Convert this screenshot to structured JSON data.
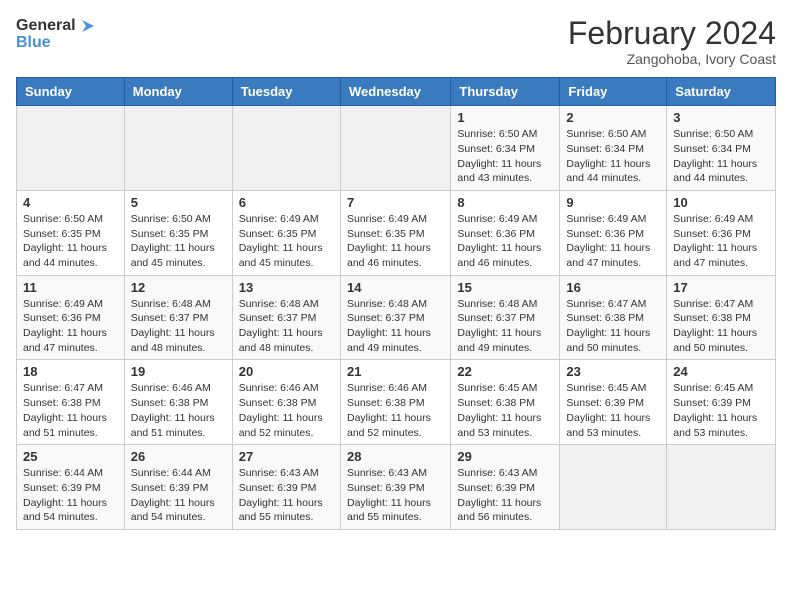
{
  "header": {
    "logo_line1": "General",
    "logo_line2": "Blue",
    "month_year": "February 2024",
    "location": "Zangohoba, Ivory Coast"
  },
  "days_of_week": [
    "Sunday",
    "Monday",
    "Tuesday",
    "Wednesday",
    "Thursday",
    "Friday",
    "Saturday"
  ],
  "weeks": [
    [
      {
        "day": "",
        "info": ""
      },
      {
        "day": "",
        "info": ""
      },
      {
        "day": "",
        "info": ""
      },
      {
        "day": "",
        "info": ""
      },
      {
        "day": "1",
        "info": "Sunrise: 6:50 AM\nSunset: 6:34 PM\nDaylight: 11 hours and 43 minutes."
      },
      {
        "day": "2",
        "info": "Sunrise: 6:50 AM\nSunset: 6:34 PM\nDaylight: 11 hours and 44 minutes."
      },
      {
        "day": "3",
        "info": "Sunrise: 6:50 AM\nSunset: 6:34 PM\nDaylight: 11 hours and 44 minutes."
      }
    ],
    [
      {
        "day": "4",
        "info": "Sunrise: 6:50 AM\nSunset: 6:35 PM\nDaylight: 11 hours and 44 minutes."
      },
      {
        "day": "5",
        "info": "Sunrise: 6:50 AM\nSunset: 6:35 PM\nDaylight: 11 hours and 45 minutes."
      },
      {
        "day": "6",
        "info": "Sunrise: 6:49 AM\nSunset: 6:35 PM\nDaylight: 11 hours and 45 minutes."
      },
      {
        "day": "7",
        "info": "Sunrise: 6:49 AM\nSunset: 6:35 PM\nDaylight: 11 hours and 46 minutes."
      },
      {
        "day": "8",
        "info": "Sunrise: 6:49 AM\nSunset: 6:36 PM\nDaylight: 11 hours and 46 minutes."
      },
      {
        "day": "9",
        "info": "Sunrise: 6:49 AM\nSunset: 6:36 PM\nDaylight: 11 hours and 47 minutes."
      },
      {
        "day": "10",
        "info": "Sunrise: 6:49 AM\nSunset: 6:36 PM\nDaylight: 11 hours and 47 minutes."
      }
    ],
    [
      {
        "day": "11",
        "info": "Sunrise: 6:49 AM\nSunset: 6:36 PM\nDaylight: 11 hours and 47 minutes."
      },
      {
        "day": "12",
        "info": "Sunrise: 6:48 AM\nSunset: 6:37 PM\nDaylight: 11 hours and 48 minutes."
      },
      {
        "day": "13",
        "info": "Sunrise: 6:48 AM\nSunset: 6:37 PM\nDaylight: 11 hours and 48 minutes."
      },
      {
        "day": "14",
        "info": "Sunrise: 6:48 AM\nSunset: 6:37 PM\nDaylight: 11 hours and 49 minutes."
      },
      {
        "day": "15",
        "info": "Sunrise: 6:48 AM\nSunset: 6:37 PM\nDaylight: 11 hours and 49 minutes."
      },
      {
        "day": "16",
        "info": "Sunrise: 6:47 AM\nSunset: 6:38 PM\nDaylight: 11 hours and 50 minutes."
      },
      {
        "day": "17",
        "info": "Sunrise: 6:47 AM\nSunset: 6:38 PM\nDaylight: 11 hours and 50 minutes."
      }
    ],
    [
      {
        "day": "18",
        "info": "Sunrise: 6:47 AM\nSunset: 6:38 PM\nDaylight: 11 hours and 51 minutes."
      },
      {
        "day": "19",
        "info": "Sunrise: 6:46 AM\nSunset: 6:38 PM\nDaylight: 11 hours and 51 minutes."
      },
      {
        "day": "20",
        "info": "Sunrise: 6:46 AM\nSunset: 6:38 PM\nDaylight: 11 hours and 52 minutes."
      },
      {
        "day": "21",
        "info": "Sunrise: 6:46 AM\nSunset: 6:38 PM\nDaylight: 11 hours and 52 minutes."
      },
      {
        "day": "22",
        "info": "Sunrise: 6:45 AM\nSunset: 6:38 PM\nDaylight: 11 hours and 53 minutes."
      },
      {
        "day": "23",
        "info": "Sunrise: 6:45 AM\nSunset: 6:39 PM\nDaylight: 11 hours and 53 minutes."
      },
      {
        "day": "24",
        "info": "Sunrise: 6:45 AM\nSunset: 6:39 PM\nDaylight: 11 hours and 53 minutes."
      }
    ],
    [
      {
        "day": "25",
        "info": "Sunrise: 6:44 AM\nSunset: 6:39 PM\nDaylight: 11 hours and 54 minutes."
      },
      {
        "day": "26",
        "info": "Sunrise: 6:44 AM\nSunset: 6:39 PM\nDaylight: 11 hours and 54 minutes."
      },
      {
        "day": "27",
        "info": "Sunrise: 6:43 AM\nSunset: 6:39 PM\nDaylight: 11 hours and 55 minutes."
      },
      {
        "day": "28",
        "info": "Sunrise: 6:43 AM\nSunset: 6:39 PM\nDaylight: 11 hours and 55 minutes."
      },
      {
        "day": "29",
        "info": "Sunrise: 6:43 AM\nSunset: 6:39 PM\nDaylight: 11 hours and 56 minutes."
      },
      {
        "day": "",
        "info": ""
      },
      {
        "day": "",
        "info": ""
      }
    ]
  ]
}
